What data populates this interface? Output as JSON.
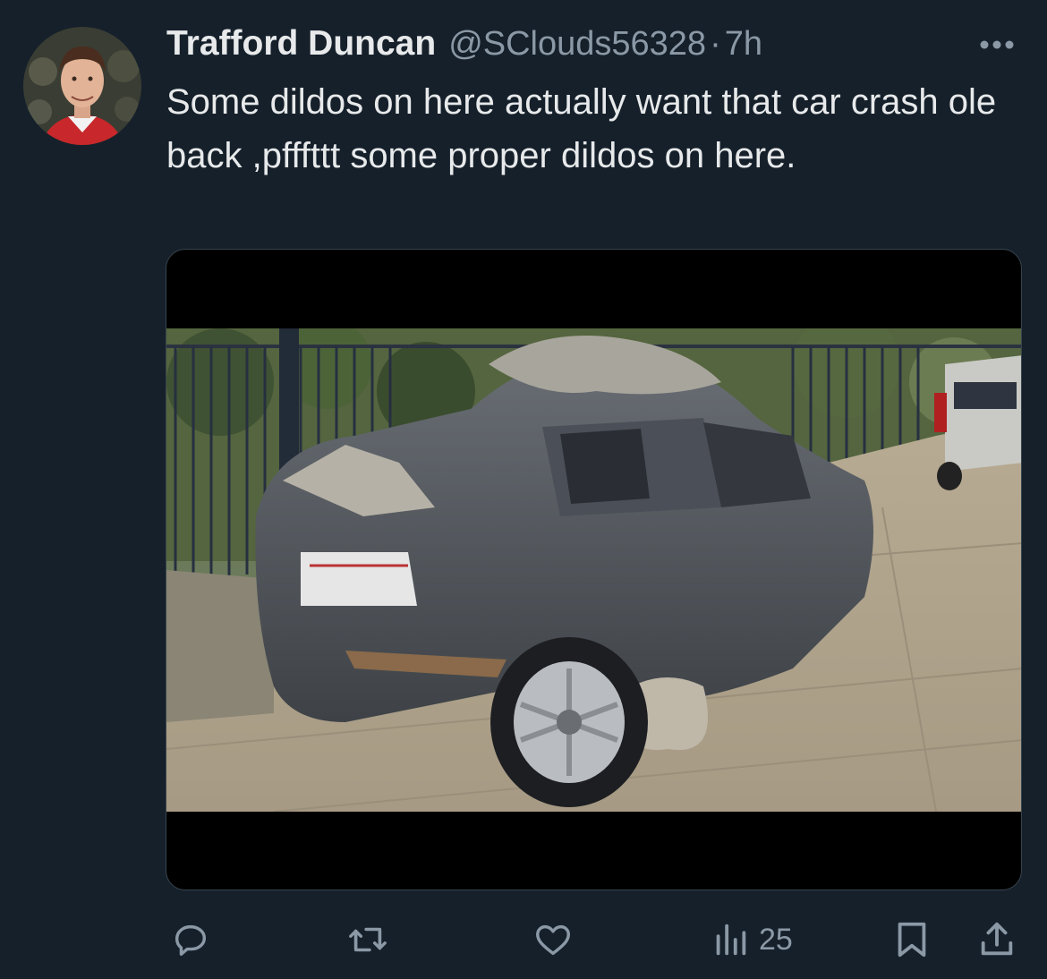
{
  "tweet": {
    "author_name": "Trafford Duncan",
    "handle": "@SClouds56328",
    "separator": "·",
    "time": "7h",
    "text": "Some dildos on here actually want that car crash ole back ,pfffttt some proper dildos on here."
  },
  "actions": {
    "views_count": "25"
  },
  "icons": {
    "more": "more-horizontal-icon",
    "reply": "reply-icon",
    "retweet": "retweet-icon",
    "like": "heart-icon",
    "views": "views-icon",
    "bookmark": "bookmark-icon",
    "share": "share-icon"
  },
  "colors": {
    "background": "#15202b",
    "text": "#e7e9ea",
    "secondary": "#8b98a5"
  }
}
